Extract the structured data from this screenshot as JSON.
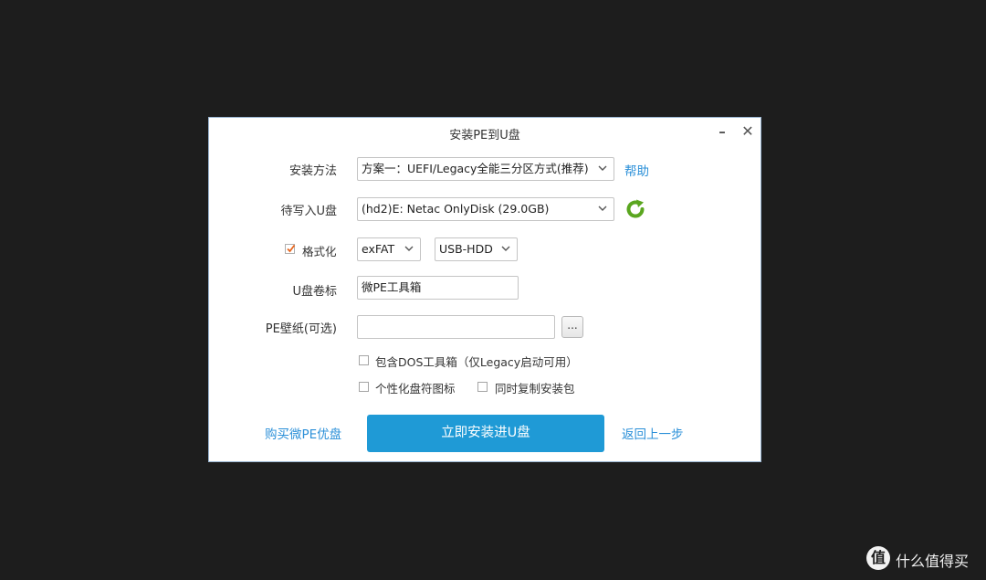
{
  "window": {
    "title": "安装PE到U盘",
    "minimize_glyph": "–",
    "close_glyph": "✕"
  },
  "form": {
    "install_method": {
      "label": "安装方法",
      "value": "方案一：UEFI/Legacy全能三分区方式(推荐)",
      "help_link": "帮助"
    },
    "target_disk": {
      "label": "待写入U盘",
      "value": "(hd2)E: Netac OnlyDisk (29.0GB)",
      "refresh_icon": "refresh-icon"
    },
    "format": {
      "label": "格式化",
      "checked": true,
      "filesystem": "exFAT",
      "mode": "USB-HDD"
    },
    "volume_label": {
      "label": "U盘卷标",
      "value": "微PE工具箱"
    },
    "wallpaper": {
      "label": "PE壁纸(可选)",
      "value": "",
      "browse_label": "..."
    },
    "options": {
      "include_dos": {
        "label": "包含DOS工具箱（仅Legacy启动可用）",
        "checked": false
      },
      "custom_icon": {
        "label": "个性化盘符图标",
        "checked": false
      },
      "copy_package": {
        "label": "同时复制安装包",
        "checked": false
      }
    }
  },
  "footer": {
    "buy_link": "购买微PE优盘",
    "install_button": "立即安装进U盘",
    "back_link": "返回上一步"
  },
  "colors": {
    "accent": "#1f9ad6",
    "link": "#2a8fd8",
    "refresh_green": "#5aa61f",
    "check_orange": "#e8641b",
    "background": "#1d1d1d"
  },
  "watermark": {
    "icon": "值",
    "text": "什么值得买"
  }
}
